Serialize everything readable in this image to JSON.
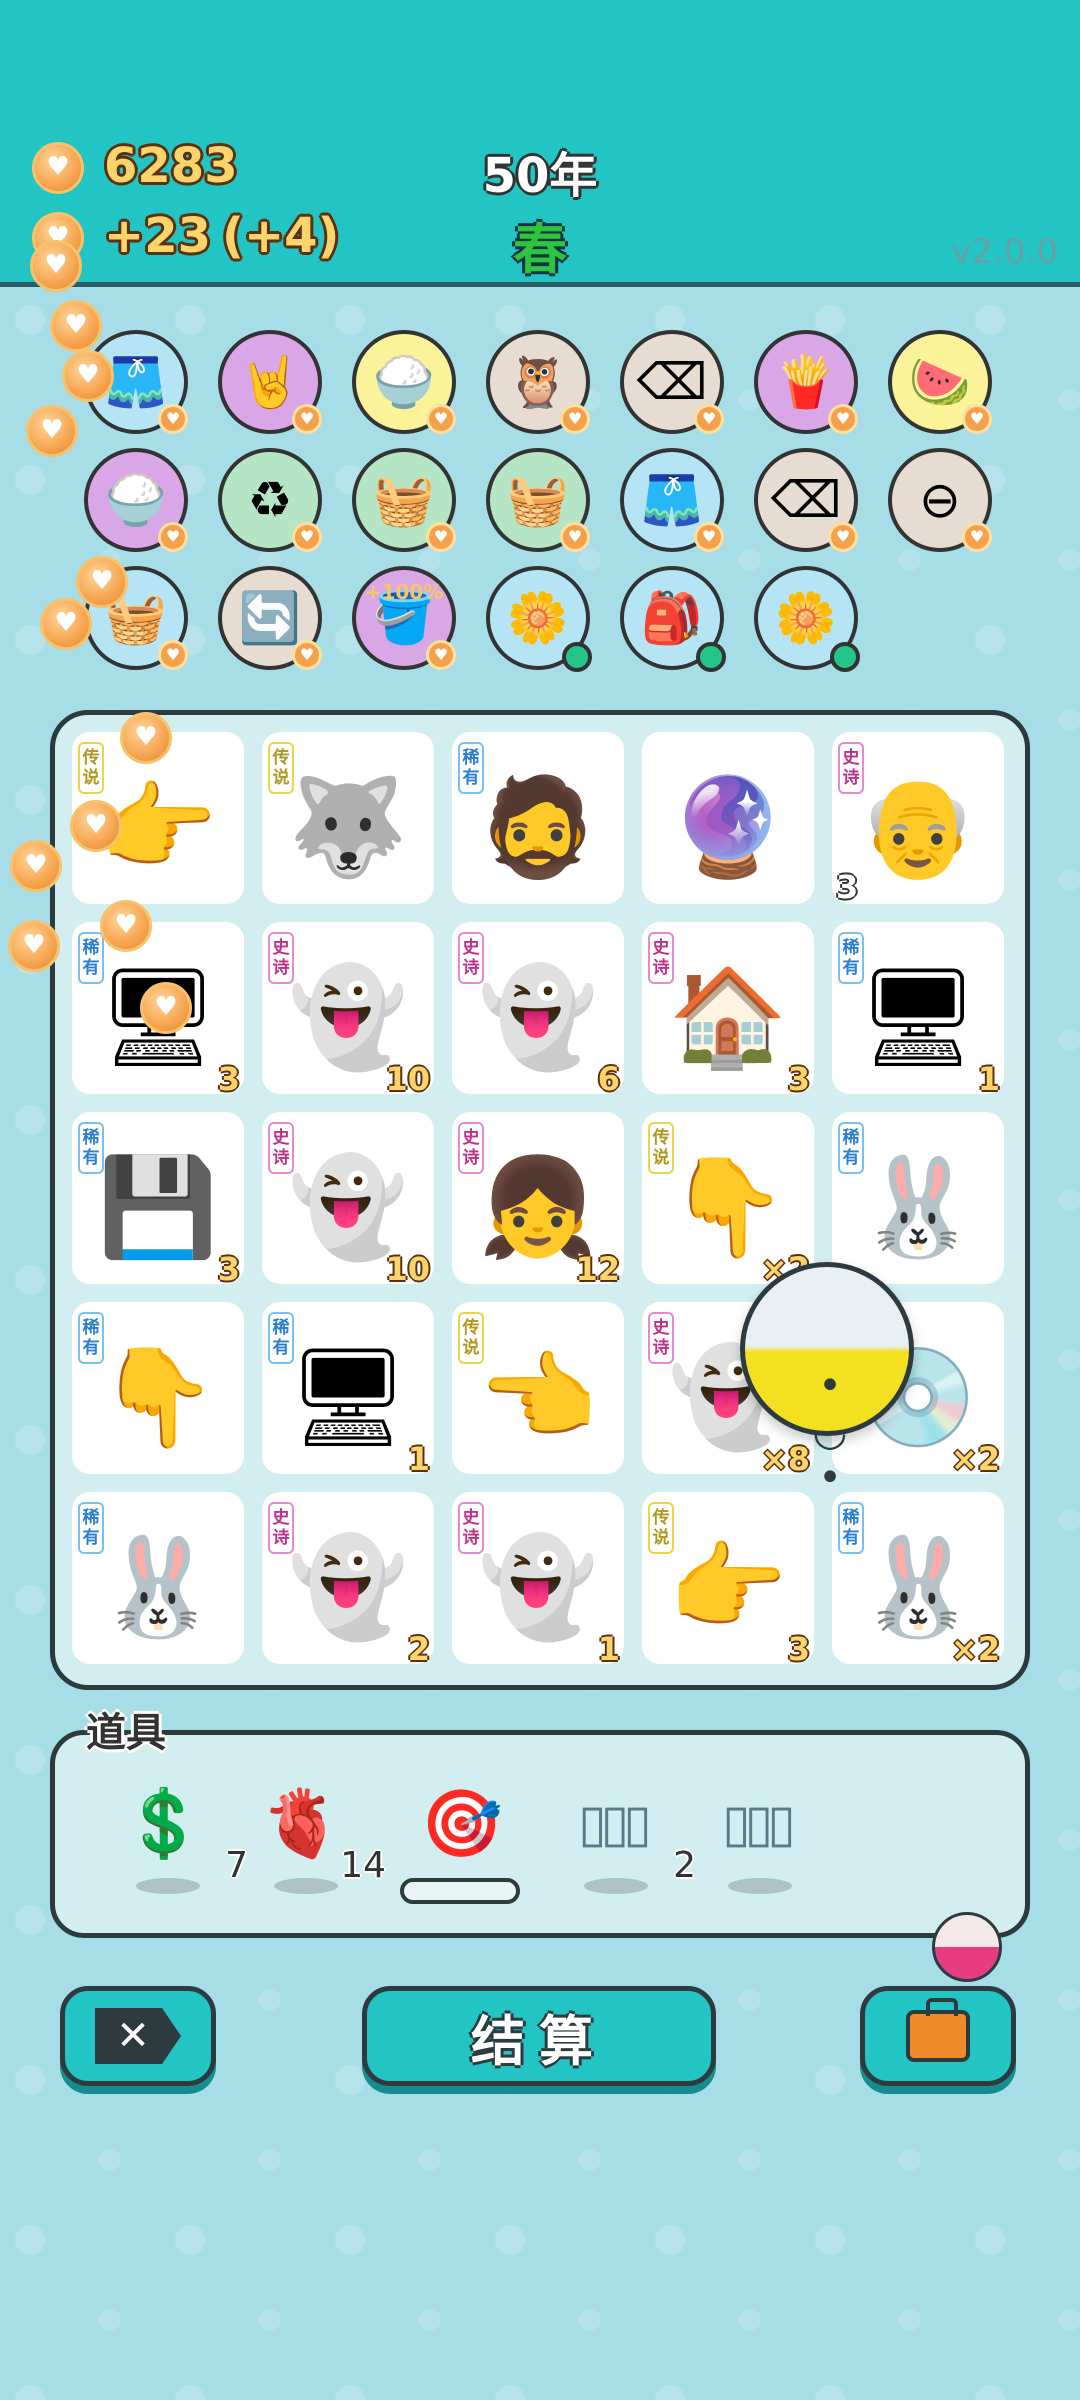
{
  "header": {
    "coins": "6283",
    "income": "+23",
    "bonus": "(+4)",
    "year": "50年",
    "season": "春",
    "version": "v2.0.0"
  },
  "relics": [
    {
      "icon": "skirt-icon",
      "glyph": "🩳",
      "bg": "#b5e5f5"
    },
    {
      "icon": "rock-hand-icon",
      "glyph": "🤘",
      "bg": "#d9a6e6"
    },
    {
      "icon": "rice-bowl-icon",
      "glyph": "🍚",
      "bg": "#fbf39a"
    },
    {
      "icon": "owl-mask-icon",
      "glyph": "🦉",
      "bg": "#e6dcd2"
    },
    {
      "icon": "delete-tag-icon",
      "glyph": "⌫",
      "bg": "#e6dcd2"
    },
    {
      "icon": "fries-icon",
      "glyph": "🍟",
      "bg": "#d9a6e6"
    },
    {
      "icon": "fruit-platter-icon",
      "glyph": "🍉",
      "bg": "#fbf39a"
    },
    {
      "icon": "rice-bowl-icon",
      "glyph": "🍚",
      "bg": "#d9a6e6"
    },
    {
      "icon": "recycle-bag-icon",
      "glyph": "♻",
      "bg": "#b5e5c5"
    },
    {
      "icon": "fruit-basket-icon",
      "glyph": "🧺",
      "bg": "#b5e5c5"
    },
    {
      "icon": "fruit-basket-icon",
      "glyph": "🧺",
      "bg": "#b5e5c5"
    },
    {
      "icon": "skirt-icon",
      "glyph": "🩳",
      "bg": "#b5e5f5"
    },
    {
      "icon": "delete-tag-icon",
      "glyph": "⌫",
      "bg": "#e6dcd2"
    },
    {
      "icon": "minus-circle-icon",
      "glyph": "⊖",
      "bg": "#e6dcd2"
    },
    {
      "icon": "fruit-basket-icon",
      "glyph": "🧺",
      "bg": "#b5e5f5"
    },
    {
      "icon": "refresh-icon",
      "glyph": "🔄",
      "bg": "#e6dcd2"
    },
    {
      "icon": "bucket-icon",
      "glyph": "🪣",
      "bg": "#d9a6e6",
      "label": "+100%"
    },
    {
      "icon": "flower-pot-icon",
      "glyph": "🌼",
      "bg": "#b5e5f5"
    },
    {
      "icon": "grain-sack-icon",
      "glyph": "🎒",
      "bg": "#b5e5f5"
    },
    {
      "icon": "flower-pot-icon",
      "glyph": "🌼",
      "bg": "#b5e5f5"
    }
  ],
  "rarity": {
    "legend": "传说",
    "epic": "史诗",
    "rare": "稀有"
  },
  "board": [
    {
      "rarity": "legend",
      "icon": "pointing-hand-icon",
      "glyph": "👉",
      "count": ""
    },
    {
      "rarity": "legend",
      "icon": "husky-king-icon",
      "glyph": "🐺",
      "count": ""
    },
    {
      "rarity": "rare",
      "icon": "hat-man-icon",
      "glyph": "🧔",
      "count": ""
    },
    {
      "rarity": "",
      "icon": "gacha-capsule-icon",
      "glyph": "🔮",
      "count": ""
    },
    {
      "rarity": "epic",
      "icon": "grandpa-icon",
      "glyph": "👴",
      "count": "",
      "countl": "3"
    },
    {
      "rarity": "rare",
      "icon": "cpu-chip-icon",
      "glyph": "🖥",
      "count": "3"
    },
    {
      "rarity": "epic",
      "icon": "love-ghost-icon",
      "glyph": "👻",
      "count": "10"
    },
    {
      "rarity": "epic",
      "icon": "love-ghost-icon",
      "glyph": "👻",
      "count": "6"
    },
    {
      "rarity": "epic",
      "icon": "bunny-house-icon",
      "glyph": "🏠",
      "count": "3"
    },
    {
      "rarity": "rare",
      "icon": "pc-tower-icon",
      "glyph": "🖥",
      "count": "1"
    },
    {
      "rarity": "rare",
      "icon": "cpu-chip-icon",
      "glyph": "💾",
      "count": "3"
    },
    {
      "rarity": "epic",
      "icon": "dead-ghost-icon",
      "glyph": "👻",
      "count": "10"
    },
    {
      "rarity": "epic",
      "icon": "girl-face-icon",
      "glyph": "👧",
      "count": "12"
    },
    {
      "rarity": "legend",
      "icon": "down-hand-icon",
      "glyph": "👇",
      "count": "×2"
    },
    {
      "rarity": "rare",
      "icon": "bunny-icon",
      "glyph": "🐰",
      "count": ""
    },
    {
      "rarity": "rare",
      "icon": "down-hand-icon",
      "glyph": "👇",
      "count": ""
    },
    {
      "rarity": "rare",
      "icon": "pc-tower-icon",
      "glyph": "🖥",
      "count": "1"
    },
    {
      "rarity": "legend",
      "icon": "pointing-hand-icon",
      "glyph": "👈",
      "count": ""
    },
    {
      "rarity": "epic",
      "icon": "dead-ghost-icon",
      "glyph": "👻",
      "count": "×8"
    },
    {
      "rarity": "",
      "icon": "disc-icon",
      "glyph": "💿",
      "count": "×2"
    },
    {
      "rarity": "rare",
      "icon": "bunny-icon",
      "glyph": "🐰",
      "count": ""
    },
    {
      "rarity": "epic",
      "icon": "dead-ghost-icon",
      "glyph": "👻",
      "count": "2"
    },
    {
      "rarity": "epic",
      "icon": "dead-ghost-icon",
      "glyph": "👻",
      "count": "1"
    },
    {
      "rarity": "legend",
      "icon": "pointing-hand-icon",
      "glyph": "👉",
      "count": "3"
    },
    {
      "rarity": "rare",
      "icon": "bunny-icon",
      "glyph": "🐰",
      "count": "×2"
    }
  ],
  "items": {
    "title": "道具",
    "list": [
      {
        "icon": "coin-dollar-icon",
        "glyph": "💲",
        "count": "7"
      },
      {
        "icon": "liver-icon",
        "glyph": "🫀",
        "count": "14"
      },
      {
        "icon": "target-icon",
        "glyph": "🎯",
        "count": ""
      },
      {
        "icon": "three-slot-icon",
        "glyph": "▯▯▯",
        "count": "2"
      },
      {
        "icon": "rare-slot-icon",
        "glyph": "▯▯▯",
        "count": ""
      }
    ]
  },
  "buttons": {
    "settle": "结算"
  }
}
